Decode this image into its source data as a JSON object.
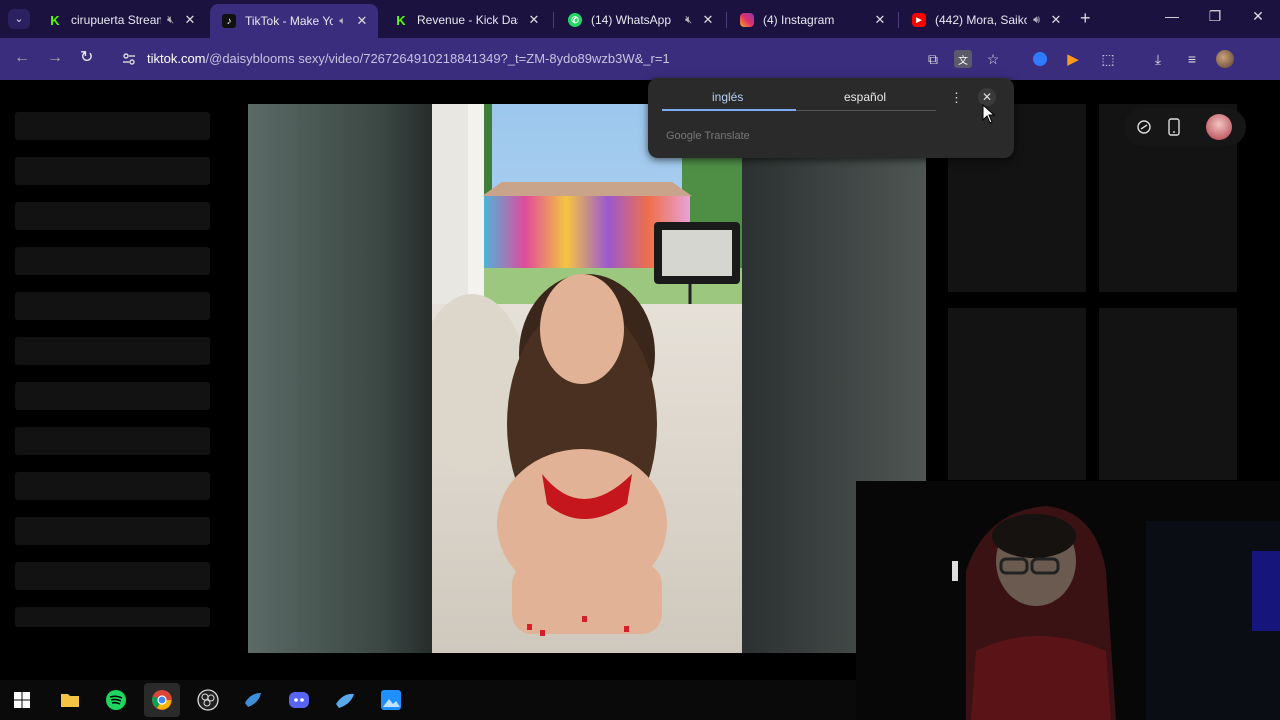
{
  "browser": {
    "tabs": [
      {
        "title": "cirupuerta Stream",
        "favicon": "kick-icon",
        "favicon_color": "#53fc18",
        "muted": true,
        "active": false
      },
      {
        "title": "TikTok - Make Yo",
        "favicon": "tiktok-icon",
        "favicon_color": "#ffffff",
        "muted": true,
        "active": true
      },
      {
        "title": "Revenue - Kick Dashb",
        "favicon": "kick-icon",
        "favicon_color": "#53fc18",
        "muted": false,
        "active": false
      },
      {
        "title": "(14) WhatsApp",
        "favicon": "whatsapp-icon",
        "favicon_color": "#25d366",
        "muted": true,
        "active": false
      },
      {
        "title": "(4) Instagram",
        "favicon": "instagram-icon",
        "favicon_color": "#e1306c",
        "muted": false,
        "active": false
      },
      {
        "title": "(442) Mora, Saiko",
        "favicon": "youtube-icon",
        "favicon_color": "#ff0000",
        "muted": false,
        "audio": true,
        "active": false
      }
    ],
    "url": {
      "host": "tiktok.com",
      "path": "/@daisyblooms sexy/video/7267264910218841349?_t=ZM-8ydo89wzb3W&_r=1"
    }
  },
  "translate_popup": {
    "source_lang": "inglés",
    "target_lang": "español",
    "brand": "Google Translate"
  },
  "colors": {
    "tabstrip": "#1b1240",
    "toolbar": "#3a2d7d",
    "accent": "#7cacf8"
  },
  "taskbar": {
    "apps": [
      "windows-start-icon",
      "file-explorer-icon",
      "spotify-icon",
      "chrome-icon",
      "obs-icon",
      "steam-icon",
      "discord-icon",
      "steam-alt-icon",
      "photos-icon"
    ]
  }
}
